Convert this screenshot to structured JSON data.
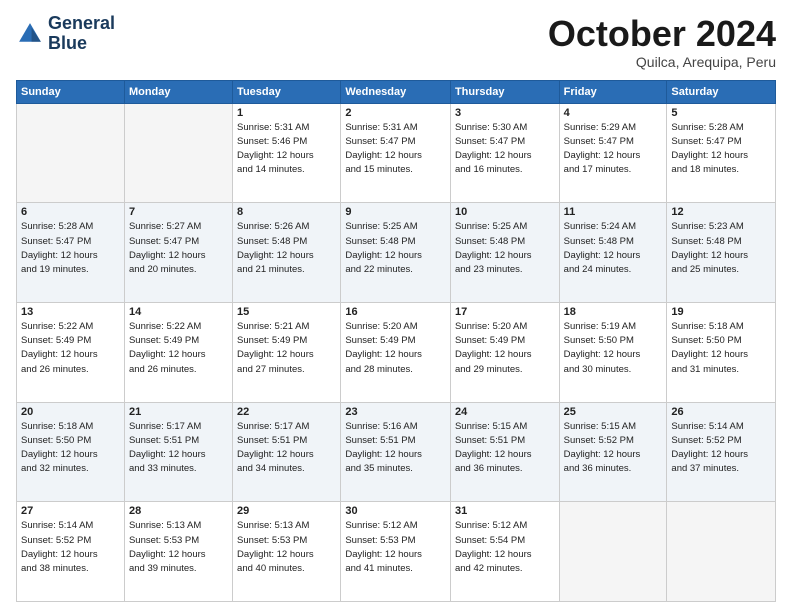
{
  "header": {
    "logo_line1": "General",
    "logo_line2": "Blue",
    "month": "October 2024",
    "location": "Quilca, Arequipa, Peru"
  },
  "weekdays": [
    "Sunday",
    "Monday",
    "Tuesday",
    "Wednesday",
    "Thursday",
    "Friday",
    "Saturday"
  ],
  "weeks": [
    [
      {
        "day": "",
        "info": ""
      },
      {
        "day": "",
        "info": ""
      },
      {
        "day": "1",
        "sunrise": "5:31 AM",
        "sunset": "5:46 PM",
        "daylight": "12 hours and 14 minutes."
      },
      {
        "day": "2",
        "sunrise": "5:31 AM",
        "sunset": "5:47 PM",
        "daylight": "12 hours and 15 minutes."
      },
      {
        "day": "3",
        "sunrise": "5:30 AM",
        "sunset": "5:47 PM",
        "daylight": "12 hours and 16 minutes."
      },
      {
        "day": "4",
        "sunrise": "5:29 AM",
        "sunset": "5:47 PM",
        "daylight": "12 hours and 17 minutes."
      },
      {
        "day": "5",
        "sunrise": "5:28 AM",
        "sunset": "5:47 PM",
        "daylight": "12 hours and 18 minutes."
      }
    ],
    [
      {
        "day": "6",
        "sunrise": "5:28 AM",
        "sunset": "5:47 PM",
        "daylight": "12 hours and 19 minutes."
      },
      {
        "day": "7",
        "sunrise": "5:27 AM",
        "sunset": "5:47 PM",
        "daylight": "12 hours and 20 minutes."
      },
      {
        "day": "8",
        "sunrise": "5:26 AM",
        "sunset": "5:48 PM",
        "daylight": "12 hours and 21 minutes."
      },
      {
        "day": "9",
        "sunrise": "5:25 AM",
        "sunset": "5:48 PM",
        "daylight": "12 hours and 22 minutes."
      },
      {
        "day": "10",
        "sunrise": "5:25 AM",
        "sunset": "5:48 PM",
        "daylight": "12 hours and 23 minutes."
      },
      {
        "day": "11",
        "sunrise": "5:24 AM",
        "sunset": "5:48 PM",
        "daylight": "12 hours and 24 minutes."
      },
      {
        "day": "12",
        "sunrise": "5:23 AM",
        "sunset": "5:48 PM",
        "daylight": "12 hours and 25 minutes."
      }
    ],
    [
      {
        "day": "13",
        "sunrise": "5:22 AM",
        "sunset": "5:49 PM",
        "daylight": "12 hours and 26 minutes."
      },
      {
        "day": "14",
        "sunrise": "5:22 AM",
        "sunset": "5:49 PM",
        "daylight": "12 hours and 26 minutes."
      },
      {
        "day": "15",
        "sunrise": "5:21 AM",
        "sunset": "5:49 PM",
        "daylight": "12 hours and 27 minutes."
      },
      {
        "day": "16",
        "sunrise": "5:20 AM",
        "sunset": "5:49 PM",
        "daylight": "12 hours and 28 minutes."
      },
      {
        "day": "17",
        "sunrise": "5:20 AM",
        "sunset": "5:49 PM",
        "daylight": "12 hours and 29 minutes."
      },
      {
        "day": "18",
        "sunrise": "5:19 AM",
        "sunset": "5:50 PM",
        "daylight": "12 hours and 30 minutes."
      },
      {
        "day": "19",
        "sunrise": "5:18 AM",
        "sunset": "5:50 PM",
        "daylight": "12 hours and 31 minutes."
      }
    ],
    [
      {
        "day": "20",
        "sunrise": "5:18 AM",
        "sunset": "5:50 PM",
        "daylight": "12 hours and 32 minutes."
      },
      {
        "day": "21",
        "sunrise": "5:17 AM",
        "sunset": "5:51 PM",
        "daylight": "12 hours and 33 minutes."
      },
      {
        "day": "22",
        "sunrise": "5:17 AM",
        "sunset": "5:51 PM",
        "daylight": "12 hours and 34 minutes."
      },
      {
        "day": "23",
        "sunrise": "5:16 AM",
        "sunset": "5:51 PM",
        "daylight": "12 hours and 35 minutes."
      },
      {
        "day": "24",
        "sunrise": "5:15 AM",
        "sunset": "5:51 PM",
        "daylight": "12 hours and 36 minutes."
      },
      {
        "day": "25",
        "sunrise": "5:15 AM",
        "sunset": "5:52 PM",
        "daylight": "12 hours and 36 minutes."
      },
      {
        "day": "26",
        "sunrise": "5:14 AM",
        "sunset": "5:52 PM",
        "daylight": "12 hours and 37 minutes."
      }
    ],
    [
      {
        "day": "27",
        "sunrise": "5:14 AM",
        "sunset": "5:52 PM",
        "daylight": "12 hours and 38 minutes."
      },
      {
        "day": "28",
        "sunrise": "5:13 AM",
        "sunset": "5:53 PM",
        "daylight": "12 hours and 39 minutes."
      },
      {
        "day": "29",
        "sunrise": "5:13 AM",
        "sunset": "5:53 PM",
        "daylight": "12 hours and 40 minutes."
      },
      {
        "day": "30",
        "sunrise": "5:12 AM",
        "sunset": "5:53 PM",
        "daylight": "12 hours and 41 minutes."
      },
      {
        "day": "31",
        "sunrise": "5:12 AM",
        "sunset": "5:54 PM",
        "daylight": "12 hours and 42 minutes."
      },
      {
        "day": "",
        "info": ""
      },
      {
        "day": "",
        "info": ""
      }
    ]
  ],
  "labels": {
    "sunrise": "Sunrise:",
    "sunset": "Sunset:",
    "daylight": "Daylight:"
  }
}
